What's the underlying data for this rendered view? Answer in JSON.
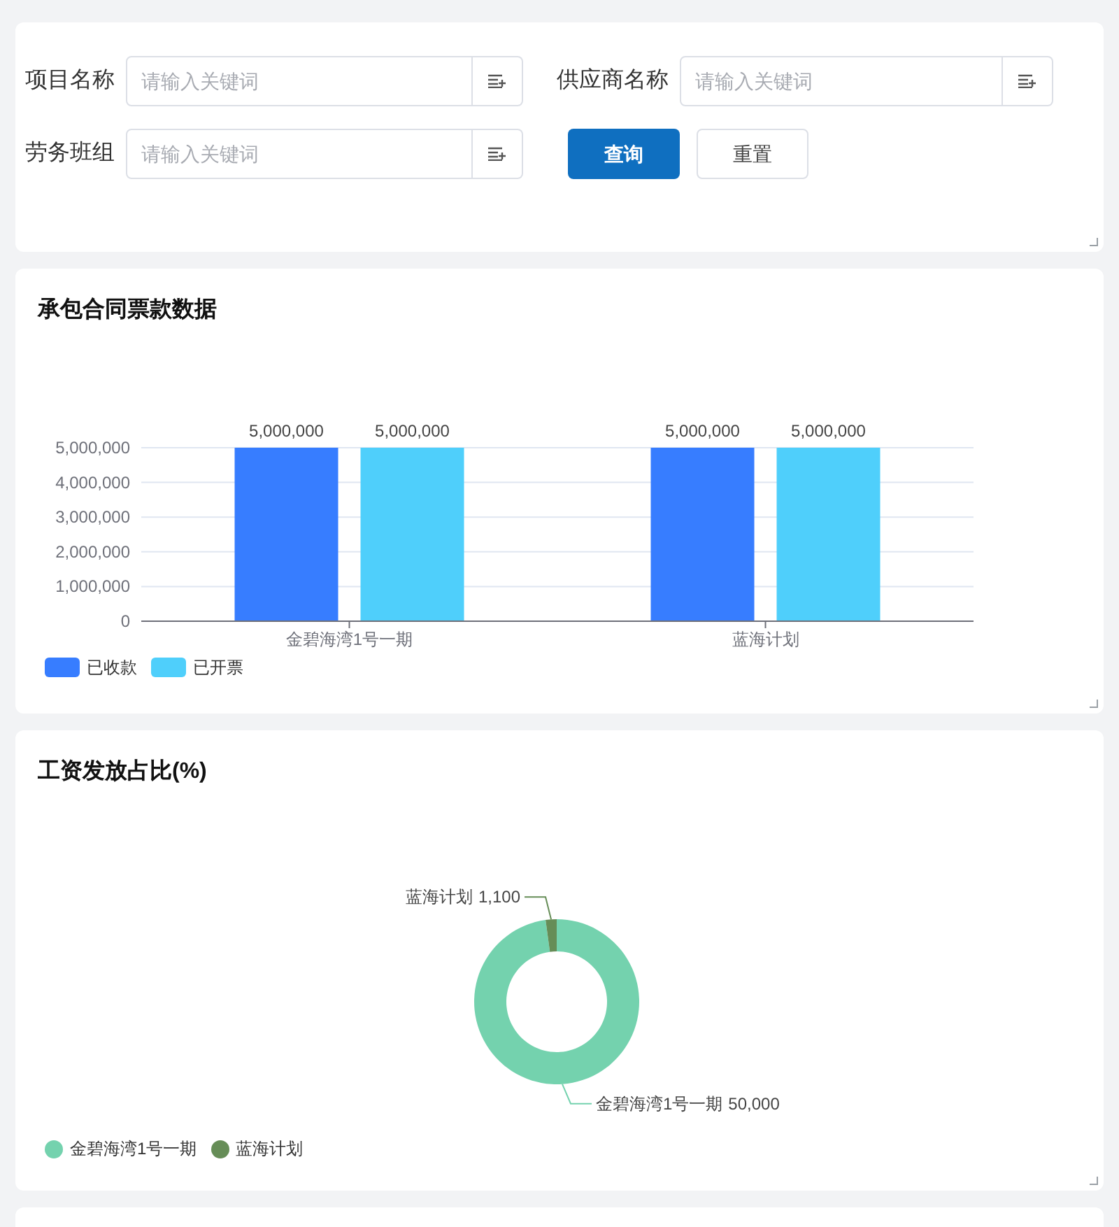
{
  "filters": [
    {
      "label": "项目名称",
      "placeholder": "请输入关键词"
    },
    {
      "label": "供应商名称",
      "placeholder": "请输入关键词"
    },
    {
      "label": "劳务班组",
      "placeholder": "请输入关键词"
    }
  ],
  "buttons": [
    {
      "label": "查询",
      "kind": "primary"
    },
    {
      "label": "重置",
      "kind": "default"
    }
  ],
  "contract_panel": {
    "title": "承包合同票款数据",
    "chart_data": {
      "type": "bar",
      "categories": [
        "金碧海湾1号一期",
        "蓝海计划"
      ],
      "series": [
        {
          "name": "已收款",
          "color": "#377dff",
          "values": [
            5000000,
            5000000
          ],
          "value_labels": [
            "5,000,000",
            "5,000,000"
          ]
        },
        {
          "name": "已开票",
          "color": "#4fcffb",
          "values": [
            5000000,
            5000000
          ],
          "value_labels": [
            "5,000,000",
            "5,000,000"
          ]
        }
      ],
      "ylim": [
        0,
        5000000
      ],
      "grid": true,
      "yticks": [
        {
          "value": 0,
          "label": "0"
        },
        {
          "value": 1000000,
          "label": "1,000,000"
        },
        {
          "value": 2000000,
          "label": "2,000,000"
        },
        {
          "value": 3000000,
          "label": "3,000,000"
        },
        {
          "value": 4000000,
          "label": "4,000,000"
        },
        {
          "value": 5000000,
          "label": "5,000,000"
        }
      ]
    }
  },
  "wage_panel": {
    "title": "工资发放占比(%)",
    "chart_data": {
      "type": "donut",
      "categories": [
        "金碧海湾1号一期",
        "蓝海计划"
      ],
      "values": [
        50000,
        1100
      ],
      "value_labels": [
        "50,000",
        "1,100"
      ]
    },
    "legend": [
      {
        "label": "金碧海湾1号一期",
        "color": "#74d2ae"
      },
      {
        "label": "蓝海计划",
        "color": "#668d57"
      }
    ]
  }
}
